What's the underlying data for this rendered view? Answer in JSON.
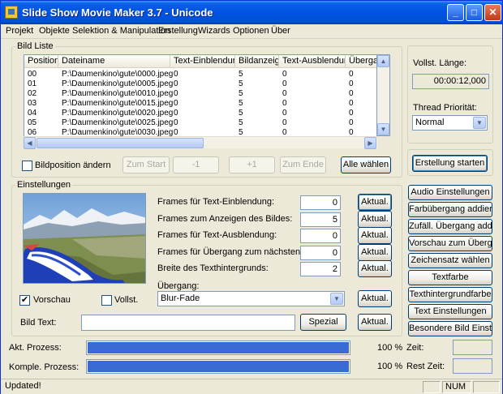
{
  "window": {
    "title": "Slide Show Movie Maker 3.7 - Unicode"
  },
  "menu": [
    "Projekt",
    "Objekte",
    "Selektion & Manipulation",
    "Erstellung",
    "Wizards",
    "Optionen",
    "Über"
  ],
  "bildliste": {
    "legend": "Bild Liste",
    "columns": [
      "Position",
      "Dateiname",
      "Text-Einblendung",
      "Bildanzeige",
      "Text-Ausblendung",
      "Übergang"
    ],
    "rows": [
      [
        "00",
        "P:\\Daumenkino\\gute\\0000.jpeg",
        "0",
        "5",
        "0",
        "0"
      ],
      [
        "01",
        "P:\\Daumenkino\\gute\\0005.jpeg",
        "0",
        "5",
        "0",
        "0"
      ],
      [
        "02",
        "P:\\Daumenkino\\gute\\0010.jpeg",
        "0",
        "5",
        "0",
        "0"
      ],
      [
        "03",
        "P:\\Daumenkino\\gute\\0015.jpeg",
        "0",
        "5",
        "0",
        "0"
      ],
      [
        "04",
        "P:\\Daumenkino\\gute\\0020.jpeg",
        "0",
        "5",
        "0",
        "0"
      ],
      [
        "05",
        "P:\\Daumenkino\\gute\\0025.jpeg",
        "0",
        "5",
        "0",
        "0"
      ],
      [
        "06",
        "P:\\Daumenkino\\gute\\0030.jpeg",
        "0",
        "5",
        "0",
        "0"
      ]
    ],
    "bildposition_label": "Bildposition ändern",
    "buttons": {
      "zum_start": "Zum Start",
      "minus1": "-1",
      "plus1": "+1",
      "zum_ende": "Zum Ende",
      "alle_waehlen": "Alle wählen"
    }
  },
  "info": {
    "laenge_label": "Vollst. Länge:",
    "laenge_value": "00:00:12,000",
    "prio_label": "Thread Priorität:",
    "prio_value": "Normal",
    "erstellung_button": "Erstellung starten"
  },
  "einstellungen": {
    "legend": "Einstellungen",
    "rows": [
      {
        "label": "Frames für Text-Einblendung:",
        "value": "0",
        "button": "Aktual."
      },
      {
        "label": "Frames zum Anzeigen des Bildes:",
        "value": "5",
        "button": "Aktual."
      },
      {
        "label": "Frames für Text-Ausblendung:",
        "value": "0",
        "button": "Aktual."
      },
      {
        "label": "Frames für Übergang zum nächsten Bild:",
        "value": "0",
        "button": "Aktual."
      },
      {
        "label": "Breite des Texthintergrunds:",
        "value": "2",
        "button": "Aktual."
      }
    ],
    "uebergang_label": "Übergang:",
    "uebergang_value": "Blur-Fade",
    "uebergang_button": "Aktual.",
    "vorschau_label": "Vorschau",
    "vorschau_checked": "✔",
    "vollst_label": "Vollst.",
    "bildtext_label": "Bild Text:",
    "bildtext_value": "",
    "spezial_button": "Spezial",
    "bildtext_button": "Aktual."
  },
  "right_buttons": [
    "Audio Einstellungen",
    "Farbübergang addier.",
    "Zufäll. Übergang addier.",
    "Vorschau zum Übergang",
    "Zeichensatz wählen",
    "Textfarbe",
    "Texthintergrundfarbe",
    "Text Einstellungen",
    "Besondere Bild Einst."
  ],
  "progress": {
    "akt_label": "Akt. Prozess:",
    "akt_percent": "100 %",
    "akt_value": 1.0,
    "kompl_label": "Komple. Prozess:",
    "kompl_percent": "100 %",
    "kompl_value": 1.0,
    "zeit_label": "Zeit:",
    "restzeit_label": "Rest Zeit:"
  },
  "status": {
    "message": "Updated!",
    "num": "NUM"
  },
  "colors": {
    "title_blue": "#0053e1",
    "progress_blue": "#3a6ad3",
    "face": "#ece9d8"
  }
}
